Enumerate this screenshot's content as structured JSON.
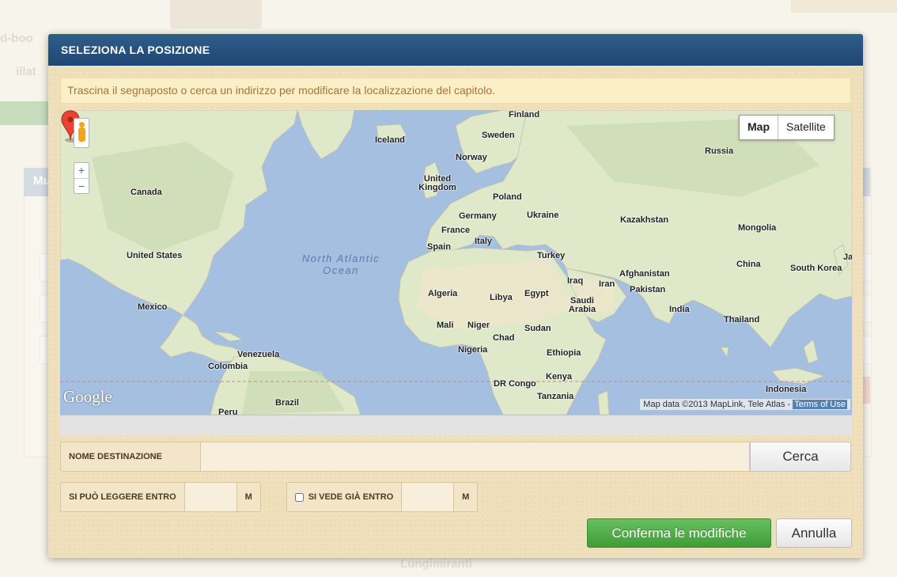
{
  "background": {
    "fragment_1": "d-boo",
    "fragment_2": "illat",
    "fragment_3": "Mu",
    "fragment_4": "Lungimiranti"
  },
  "modal": {
    "title": "SELEZIONA LA POSIZIONE",
    "info": "Trascina il segnaposto o cerca un indirizzo per modificare la localizzazione del capitolo."
  },
  "map": {
    "map_type_options": [
      "Map",
      "Satellite"
    ],
    "selected_map_type": "Map",
    "zoom_in": "+",
    "zoom_out": "−",
    "logo": "Google",
    "attribution": "Map data ©2013 MapLink, Tele Atlas - ",
    "terms": "Terms of Use",
    "ocean_label": "North Atlantic Ocean",
    "labels": {
      "finland": "Finland",
      "sweden": "Sweden",
      "iceland": "Iceland",
      "norway": "Norway",
      "russia": "Russia",
      "united_kingdom": "United Kingdom",
      "poland": "Poland",
      "canada": "Canada",
      "germany": "Germany",
      "ukraine": "Ukraine",
      "kazakhstan": "Kazakhstan",
      "france": "France",
      "mongolia": "Mongolia",
      "spain": "Spain",
      "italy": "Italy",
      "united_states": "United States",
      "turkey": "Turkey",
      "china": "China",
      "south_korea": "South Korea",
      "japan": "Ja",
      "afghanistan": "Afghanistan",
      "iraq": "Iraq",
      "iran": "Iran",
      "pakistan": "Pakistan",
      "algeria": "Algeria",
      "libya": "Libya",
      "egypt": "Egypt",
      "saudi_arabia": "Saudi Arabia",
      "mexico": "Mexico",
      "india": "India",
      "mali": "Mali",
      "niger": "Niger",
      "sudan": "Sudan",
      "chad": "Chad",
      "thailand": "Thailand",
      "nigeria": "Nigeria",
      "venezuela": "Venezuela",
      "ethiopia": "Ethiopia",
      "colombia": "Colombia",
      "kenya": "Kenya",
      "dr_congo": "DR Congo",
      "indonesia": "Indonesia",
      "tanzania": "Tanzania",
      "brazil": "Brazil",
      "peru": "Peru"
    }
  },
  "form": {
    "destination_label": "NOME DESTINAZIONE",
    "destination_value": "",
    "search_button": "Cerca",
    "readable_label": "SI PUÒ LEGGERE ENTRO",
    "readable_value": "",
    "readable_unit": "M",
    "visible_label": "SI VEDE GIÀ ENTRO",
    "visible_checked": false,
    "visible_value": "",
    "visible_unit": "M"
  },
  "buttons": {
    "confirm": "Conferma le modifiche",
    "cancel": "Annulla"
  },
  "colors": {
    "header": "#234c78",
    "confirm": "#4ea845",
    "modal_bg": "#efdfba",
    "water": "#a4bfe0",
    "land": "#dfe8c9"
  }
}
